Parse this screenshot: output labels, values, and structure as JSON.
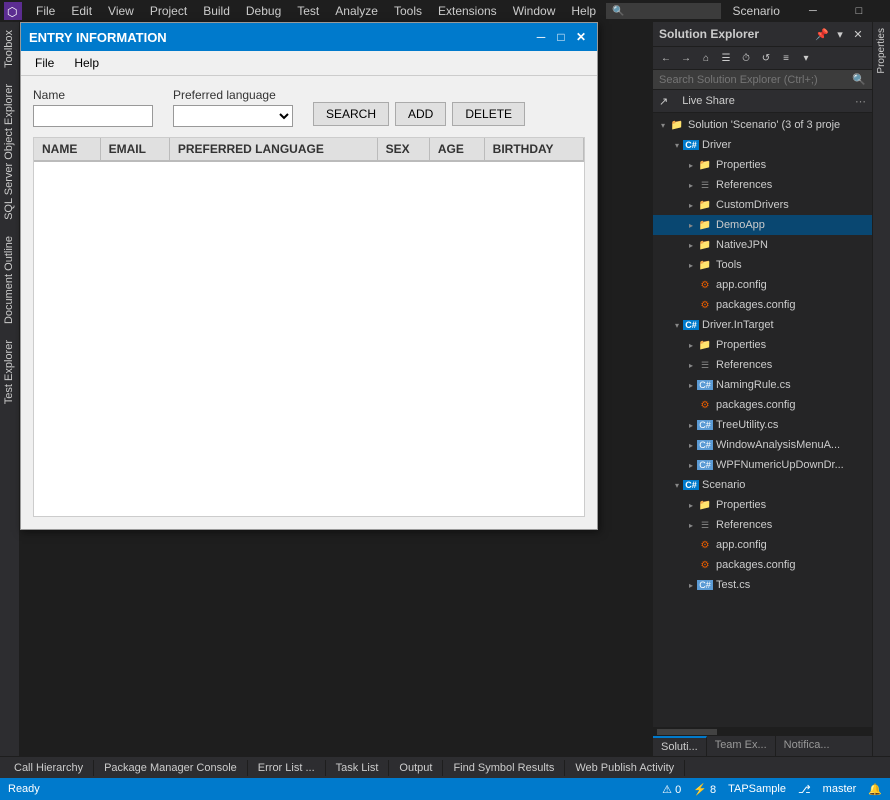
{
  "app": {
    "title": "Scenario",
    "logo_symbol": "▶",
    "vs_logo": "⬡"
  },
  "menu": {
    "items": [
      "File",
      "Edit",
      "View",
      "Project",
      "Build",
      "Debug",
      "Test",
      "Analyze",
      "Tools",
      "Extensions",
      "Window",
      "Help"
    ]
  },
  "window_controls": {
    "minimize": "─",
    "maximize": "□",
    "close": "✕"
  },
  "dialog": {
    "title": "ENTRY INFORMATION",
    "menu_items": [
      "File",
      "Help"
    ],
    "form": {
      "name_label": "Name",
      "pref_lang_label": "Preferred language",
      "name_placeholder": "",
      "lang_placeholder": "",
      "search_btn": "SEARCH",
      "add_btn": "ADD",
      "delete_btn": "DELETE"
    },
    "table": {
      "columns": [
        "NAME",
        "EMAIL",
        "PREFERRED LANGUAGE",
        "SEX",
        "AGE",
        "BIRTHDAY"
      ],
      "rows": []
    }
  },
  "solution_explorer": {
    "title": "Solution Explorer",
    "search_placeholder": "Search Solution Explorer (Ctrl+;)",
    "live_share_label": "Live Share",
    "solution_label": "Solution 'Scenario' (3 of 3 proje",
    "toolbar_icons": [
      "←",
      "→",
      "⌂",
      "☰",
      "⏱",
      "←",
      "→"
    ],
    "tree": [
      {
        "level": 0,
        "label": "Solution 'Scenario' (3 of 3 proje",
        "icon": "📁",
        "arrow": "▼",
        "type": "solution"
      },
      {
        "level": 1,
        "label": "Driver",
        "icon": "■",
        "arrow": "▼",
        "type": "project"
      },
      {
        "level": 2,
        "label": "Properties",
        "icon": "🔑",
        "arrow": "▶",
        "type": "folder"
      },
      {
        "level": 2,
        "label": "References",
        "icon": "☰",
        "arrow": "▶",
        "type": "references"
      },
      {
        "level": 2,
        "label": "CustomDrivers",
        "icon": "📁",
        "arrow": "▶",
        "type": "folder"
      },
      {
        "level": 2,
        "label": "DemoApp",
        "icon": "📁",
        "arrow": "▶",
        "type": "folder",
        "selected": true
      },
      {
        "level": 2,
        "label": "NativeJPN",
        "icon": "📁",
        "arrow": "▶",
        "type": "folder"
      },
      {
        "level": 2,
        "label": "Tools",
        "icon": "📁",
        "arrow": "▶",
        "type": "folder"
      },
      {
        "level": 2,
        "label": "app.config",
        "icon": "⚙",
        "arrow": "",
        "type": "file"
      },
      {
        "level": 2,
        "label": "packages.config",
        "icon": "⚙",
        "arrow": "",
        "type": "file"
      },
      {
        "level": 1,
        "label": "Driver.InTarget",
        "icon": "■",
        "arrow": "▼",
        "type": "project"
      },
      {
        "level": 2,
        "label": "Properties",
        "icon": "🔑",
        "arrow": "▶",
        "type": "folder"
      },
      {
        "level": 2,
        "label": "References",
        "icon": "☰",
        "arrow": "▶",
        "type": "references"
      },
      {
        "level": 2,
        "label": "NamingRule.cs",
        "icon": "C",
        "arrow": "▶",
        "type": "cs-file"
      },
      {
        "level": 2,
        "label": "packages.config",
        "icon": "⚙",
        "arrow": "",
        "type": "file"
      },
      {
        "level": 2,
        "label": "TreeUtility.cs",
        "icon": "C",
        "arrow": "▶",
        "type": "cs-file"
      },
      {
        "level": 2,
        "label": "WindowAnalysisMenuA...",
        "icon": "C",
        "arrow": "▶",
        "type": "cs-file"
      },
      {
        "level": 2,
        "label": "WPFNumericUpDownDr...",
        "icon": "C",
        "arrow": "▶",
        "type": "cs-file"
      },
      {
        "level": 1,
        "label": "Scenario",
        "icon": "■",
        "arrow": "▼",
        "type": "project"
      },
      {
        "level": 2,
        "label": "Properties",
        "icon": "🔑",
        "arrow": "▶",
        "type": "folder"
      },
      {
        "level": 2,
        "label": "References",
        "icon": "☰",
        "arrow": "▶",
        "type": "references"
      },
      {
        "level": 2,
        "label": "app.config",
        "icon": "⚙",
        "arrow": "",
        "type": "file"
      },
      {
        "level": 2,
        "label": "packages.config",
        "icon": "⚙",
        "arrow": "",
        "type": "file"
      },
      {
        "level": 2,
        "label": "Test.cs",
        "icon": "C",
        "arrow": "▶",
        "type": "cs-file"
      }
    ]
  },
  "right_panel": {
    "tab": "Properties"
  },
  "left_tabs": [
    "Toolbox",
    "SQL Server Object Explorer",
    "Document Outline",
    "Test Explorer"
  ],
  "bottom_tabs": [
    "Call Hierarchy",
    "Package Manager Console",
    "Error List ...",
    "Task List",
    "Output",
    "Find Symbol Results",
    "Web Publish Activity"
  ],
  "status_bar": {
    "ready": "Ready",
    "errors": "0",
    "warnings": "8",
    "branch": "master",
    "project": "TAPSample"
  }
}
